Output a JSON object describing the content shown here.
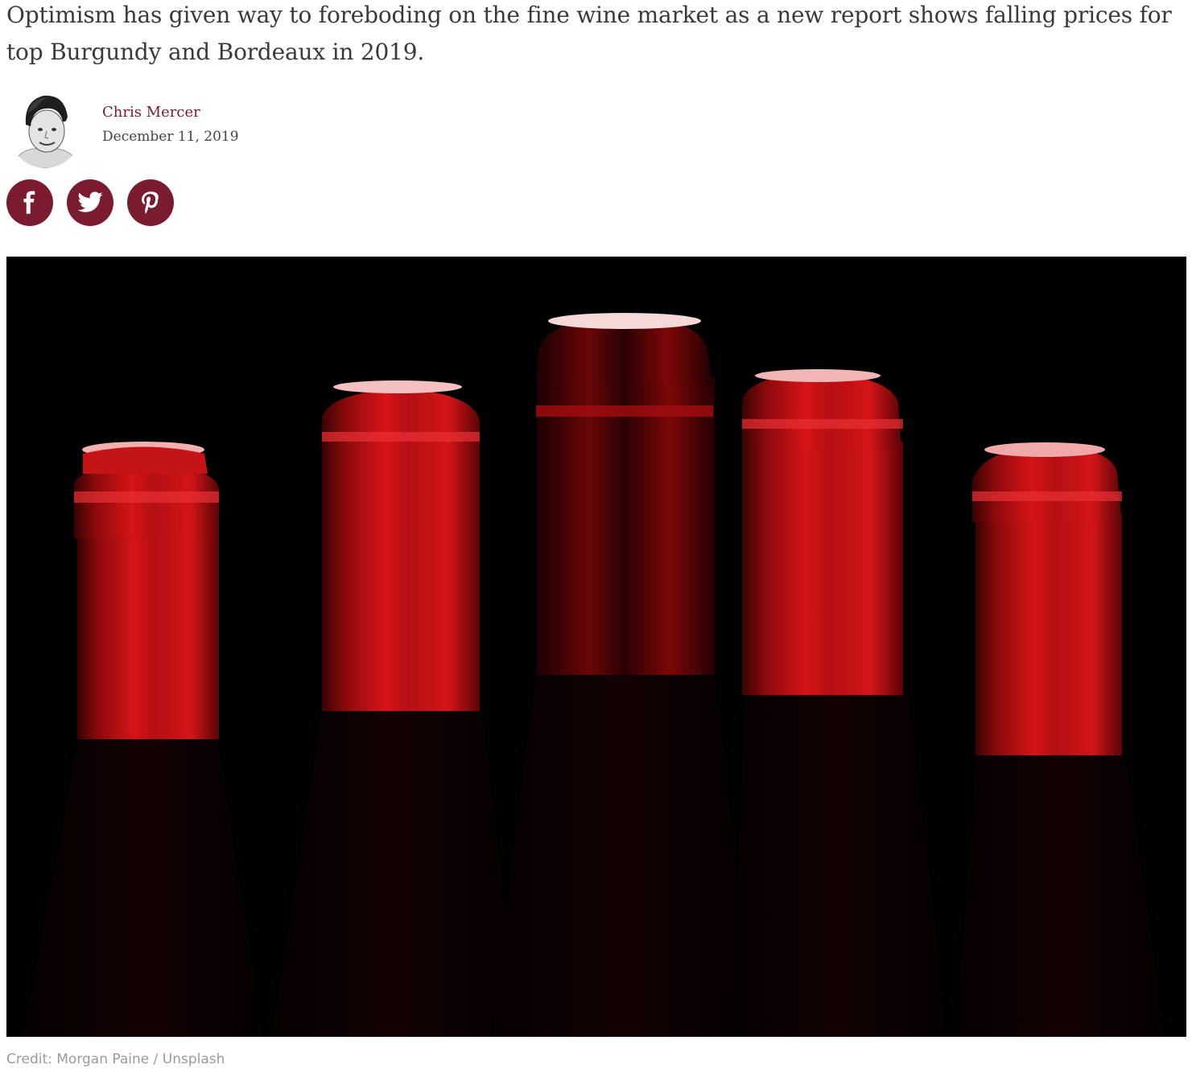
{
  "article": {
    "standfirst": "Optimism has given way to foreboding on the fine wine market as a new report shows falling prices for top Burgundy and Bordeaux in 2019."
  },
  "author": {
    "name": "Chris Mercer",
    "date": "December 11, 2019"
  },
  "share": [
    {
      "network": "facebook",
      "icon": "facebook-icon"
    },
    {
      "network": "twitter",
      "icon": "twitter-icon"
    },
    {
      "network": "pinterest",
      "icon": "pinterest-icon"
    }
  ],
  "image": {
    "credit": "Credit: Morgan Paine / Unsplash"
  },
  "colors": {
    "accent": "#7b1b2f",
    "text": "#3a3a3a",
    "credit": "#9a9a9a"
  }
}
